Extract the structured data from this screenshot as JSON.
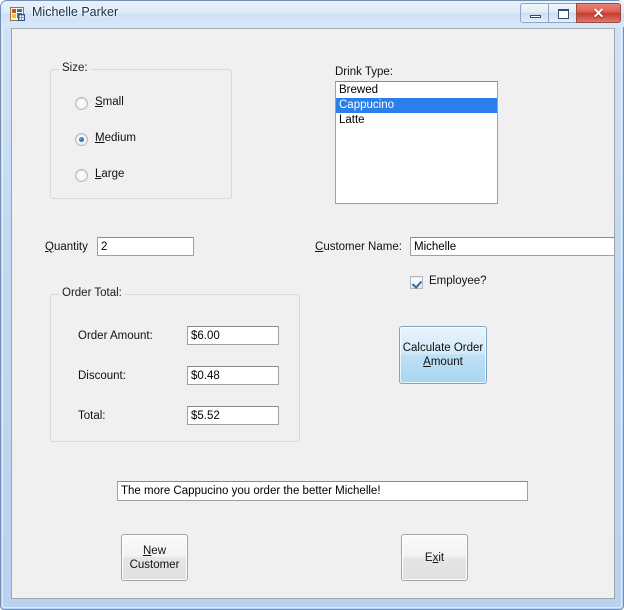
{
  "window": {
    "title": "Michelle Parker",
    "icon": "form-designer-icon",
    "controls": {
      "minimize": "minimize-button",
      "maximize": "maximize-button",
      "close_glyph": "✕"
    }
  },
  "size_group": {
    "label": "Size:",
    "options": [
      {
        "label": "Small",
        "access_key": "S",
        "checked": false
      },
      {
        "label": "Medium",
        "access_key": "M",
        "checked": true
      },
      {
        "label": "Large",
        "access_key": "L",
        "checked": false
      }
    ]
  },
  "drink_type": {
    "label": "Drink Type:",
    "items": [
      {
        "label": "Brewed",
        "selected": false
      },
      {
        "label": "Cappucino",
        "selected": true
      },
      {
        "label": "Latte",
        "selected": false
      }
    ],
    "selection_color": "#2a7fea"
  },
  "quantity": {
    "label": "Quantity",
    "access_key": "Q",
    "value": "2"
  },
  "customer": {
    "label": "Customer Name:",
    "access_key": "C",
    "value": "Michelle",
    "employee_checkbox": {
      "label": "Employee?",
      "checked": true
    }
  },
  "order_total": {
    "label": "Order Total:",
    "rows": [
      {
        "label": "Order Amount:",
        "value": "$6.00"
      },
      {
        "label": "Discount:",
        "value": "$0.48"
      },
      {
        "label": "Total:",
        "value": "$5.52"
      }
    ]
  },
  "calculate_button": {
    "line1": "Calculate Order",
    "line2_pre": "",
    "line2_key": "A",
    "line2_post": "mount"
  },
  "message": {
    "value": "The more Cappucino you order the better Michelle!"
  },
  "footer_buttons": {
    "new_customer": {
      "line1_key": "N",
      "line1_post": "ew",
      "line2": "Customer"
    },
    "exit": {
      "pre": "E",
      "key": "x",
      "post": "it"
    }
  }
}
